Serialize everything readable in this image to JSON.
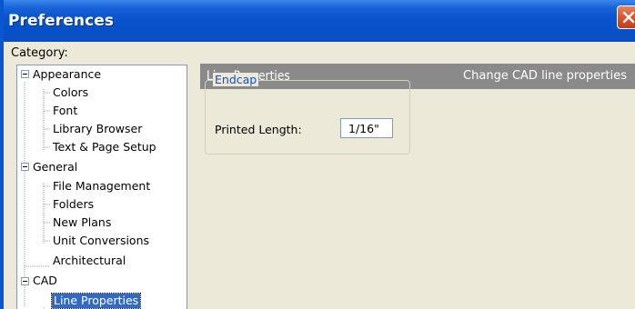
{
  "window": {
    "title": "Preferences",
    "close_icon": "close-icon",
    "title_color": "#0a55d0"
  },
  "category": {
    "label": "Category:"
  },
  "tree": {
    "appearance": {
      "label": "Appearance",
      "children": [
        "Colors",
        "Font",
        "Library Browser",
        "Text & Page Setup"
      ]
    },
    "general": {
      "label": "General",
      "children": [
        "File Management",
        "Folders",
        "New Plans",
        "Unit Conversions"
      ]
    },
    "architectural": {
      "label": "Architectural"
    },
    "cad": {
      "label": "CAD",
      "children": [
        "Line Properties"
      ]
    },
    "selected": "Line Properties"
  },
  "panel": {
    "title": "Line Properties",
    "description": "Change CAD line properties",
    "header_color": "#8a8a8a"
  },
  "endcap": {
    "legend": "Endcap",
    "printed_length_label": "Printed Length:",
    "printed_length_value": "1/16\""
  }
}
